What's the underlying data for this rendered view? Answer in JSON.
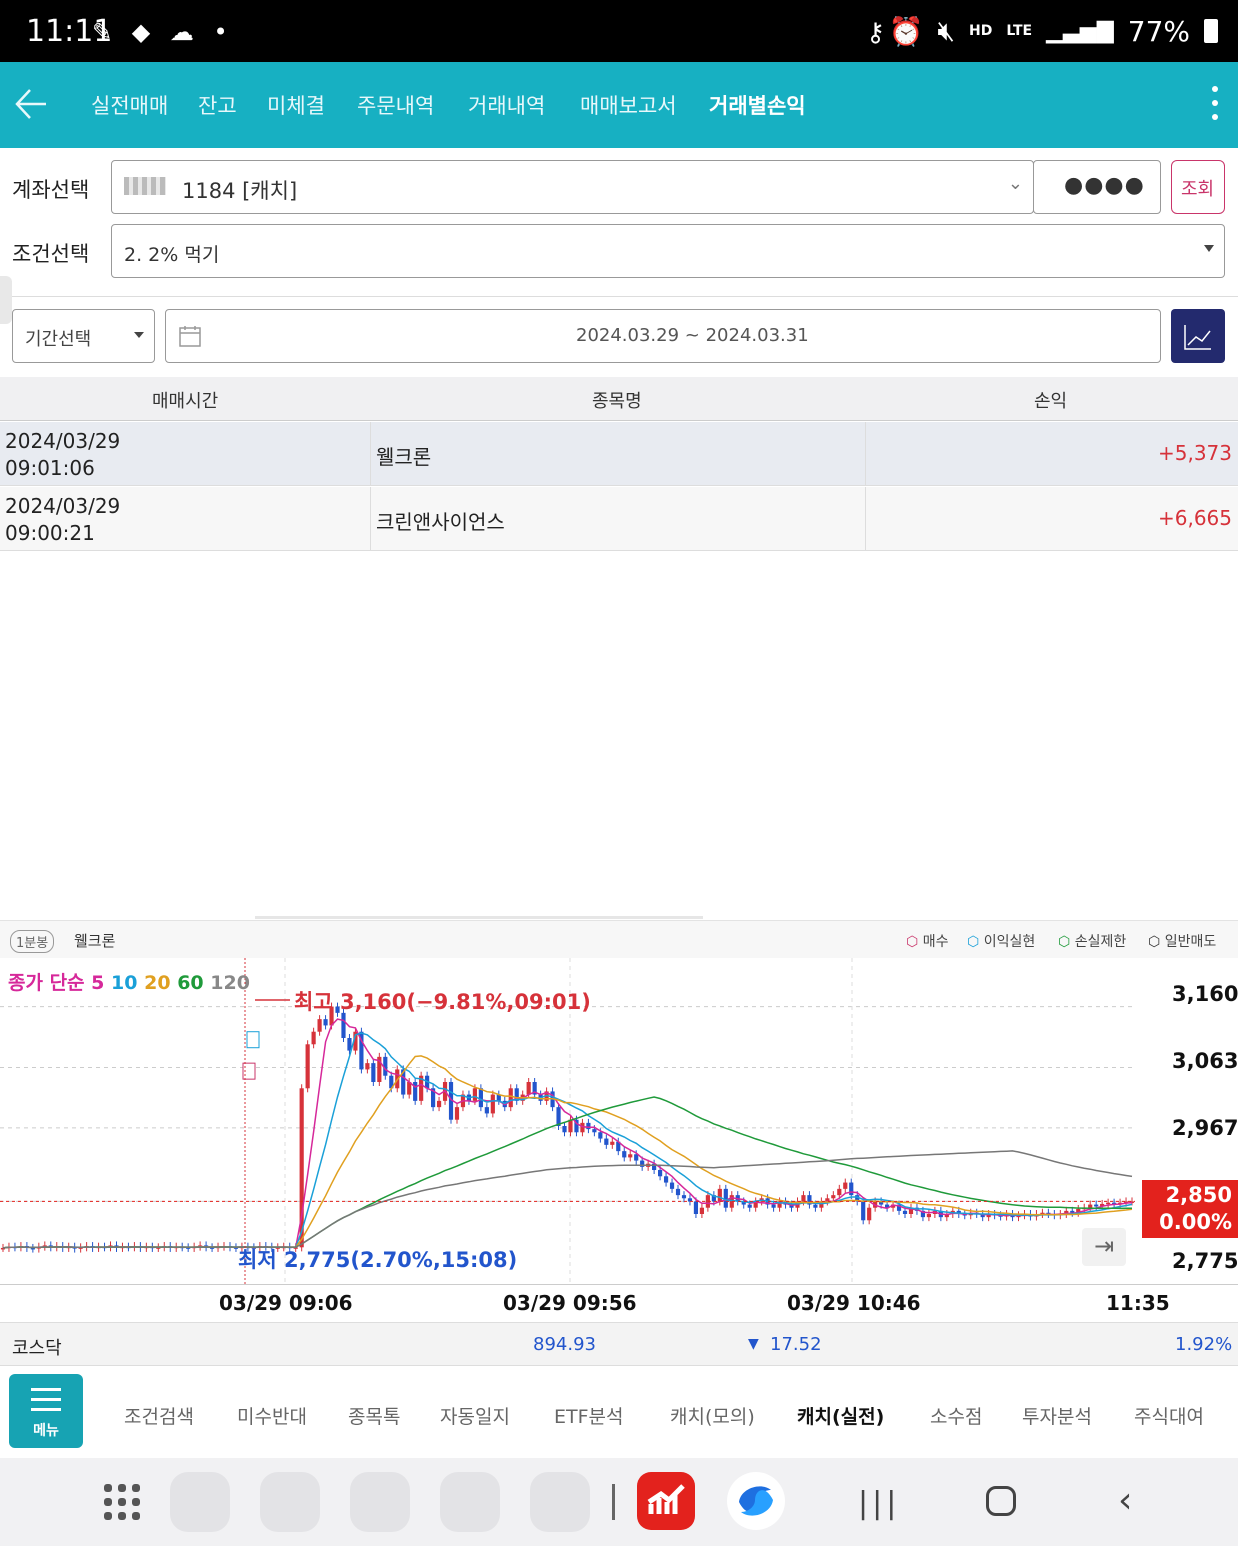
{
  "status_bar": {
    "time": "11:11",
    "battery": "77%",
    "network": "LTE",
    "hd": "HD"
  },
  "header": {
    "tabs": [
      {
        "label": "실전매매"
      },
      {
        "label": "잔고"
      },
      {
        "label": "미체결"
      },
      {
        "label": "주문내역"
      },
      {
        "label": "거래내역"
      },
      {
        "label": "매매보고서"
      },
      {
        "label": "거래별손익",
        "active": true
      }
    ]
  },
  "form": {
    "account_label": "계좌선택",
    "account_value": "1184 [캐치]",
    "password_mask": "●●●●",
    "query_button": "조회",
    "condition_label": "조건선택",
    "condition_value": "2. 2% 먹기",
    "period_select": "기간선택",
    "date_range": "2024.03.29 ~ 2024.03.31"
  },
  "table": {
    "headers": [
      "매매시간",
      "종목명",
      "손익"
    ],
    "rows": [
      {
        "date": "2024/03/29",
        "time": "09:01:06",
        "name": "웰크론",
        "pnl": "+5,373"
      },
      {
        "date": "2024/03/29",
        "time": "09:00:21",
        "name": "크린앤사이언스",
        "pnl": "+6,665"
      }
    ]
  },
  "chart_header": {
    "period": "1분봉",
    "stock": "웰크론",
    "legend": [
      "매수",
      "이익실현",
      "손실제한",
      "일반매도"
    ]
  },
  "chart_data": {
    "type": "candlestick",
    "ma_title": "종가 단순",
    "ma_periods": [
      "5",
      "10",
      "20",
      "60",
      "120"
    ],
    "ma_colors": [
      "#d6289a",
      "#1aa0d8",
      "#e0a020",
      "#1f9a3a",
      "#777777"
    ],
    "y_ticks": [
      "3,160",
      "3,063",
      "2,967",
      "2,850",
      "2,775"
    ],
    "ylim": [
      2760,
      3180
    ],
    "x_ticks": [
      "03/29 09:06",
      "03/29 09:56",
      "03/29 10:46",
      "11:35"
    ],
    "high_annotation": "최고 3,160(−9.81%,09:01)",
    "low_annotation": "최저 2,775(2.70%,15:08)",
    "current_price": "2,850",
    "current_change": "0.00%",
    "series_close": [
      2776,
      2778,
      2777,
      2779,
      2776,
      2775,
      2778,
      2780,
      2777,
      2779,
      2776,
      2778,
      2775,
      2777,
      2779,
      2776,
      2778,
      2777,
      2780,
      2776,
      2778,
      2777,
      2779,
      2776,
      2778,
      2776,
      2777,
      2779,
      2776,
      2778,
      2777,
      2776,
      2778,
      2780,
      2777,
      2776,
      2778,
      2779,
      2777,
      2776,
      2778,
      2777,
      2776,
      2779,
      2778,
      2776,
      2777,
      2778,
      2776,
      2777,
      3030,
      3100,
      3120,
      3140,
      3130,
      3160,
      3150,
      3110,
      3090,
      3120,
      3060,
      3070,
      3040,
      3080,
      3050,
      3030,
      3060,
      3020,
      3040,
      3010,
      3050,
      3030,
      3000,
      3010,
      3040,
      2980,
      3000,
      3020,
      3010,
      3030,
      3000,
      2990,
      3020,
      3010,
      3000,
      3030,
      3010,
      3020,
      3040,
      3020,
      3010,
      3025,
      3000,
      2970,
      2960,
      2980,
      2960,
      2975,
      2965,
      2960,
      2950,
      2940,
      2945,
      2930,
      2920,
      2925,
      2915,
      2905,
      2910,
      2900,
      2890,
      2880,
      2870,
      2860,
      2855,
      2850,
      2830,
      2840,
      2860,
      2850,
      2870,
      2840,
      2860,
      2850,
      2845,
      2840,
      2850,
      2855,
      2845,
      2840,
      2850,
      2845,
      2840,
      2850,
      2860,
      2845,
      2840,
      2850,
      2855,
      2860,
      2870,
      2880,
      2860,
      2850,
      2820,
      2840,
      2850,
      2845,
      2840,
      2845,
      2835,
      2830,
      2840,
      2835,
      2825,
      2830,
      2835,
      2825,
      2830,
      2835,
      2830,
      2828,
      2832,
      2830,
      2825,
      2830,
      2828,
      2826,
      2830,
      2825,
      2828,
      2830,
      2826,
      2830,
      2832,
      2830,
      2828,
      2830,
      2835,
      2832,
      2838,
      2840,
      2845,
      2842,
      2846,
      2848,
      2845,
      2848,
      2850,
      2850
    ]
  },
  "x_axis": [
    "03/29 09:06",
    "03/29 09:56",
    "03/29 10:46",
    "11:35"
  ],
  "index_bar": {
    "name": "코스닥",
    "value": "894.93",
    "change": "17.52",
    "rate": "1.92%"
  },
  "bottom_menu": {
    "menu_label": "메뉴",
    "items": [
      {
        "label": "조건검색"
      },
      {
        "label": "미수반대"
      },
      {
        "label": "종목톡"
      },
      {
        "label": "자동일지"
      },
      {
        "label": "ETF분석"
      },
      {
        "label": "캐치(모의)"
      },
      {
        "label": "캐치(실전)",
        "active": true
      },
      {
        "label": "소수점"
      },
      {
        "label": "투자분석"
      },
      {
        "label": "주식대여"
      }
    ]
  },
  "colors": {
    "accent": "#17b0c2",
    "up": "#d6323a",
    "down": "#2255cc",
    "query_border": "#c9356a",
    "chart_button": "#232a6e"
  }
}
